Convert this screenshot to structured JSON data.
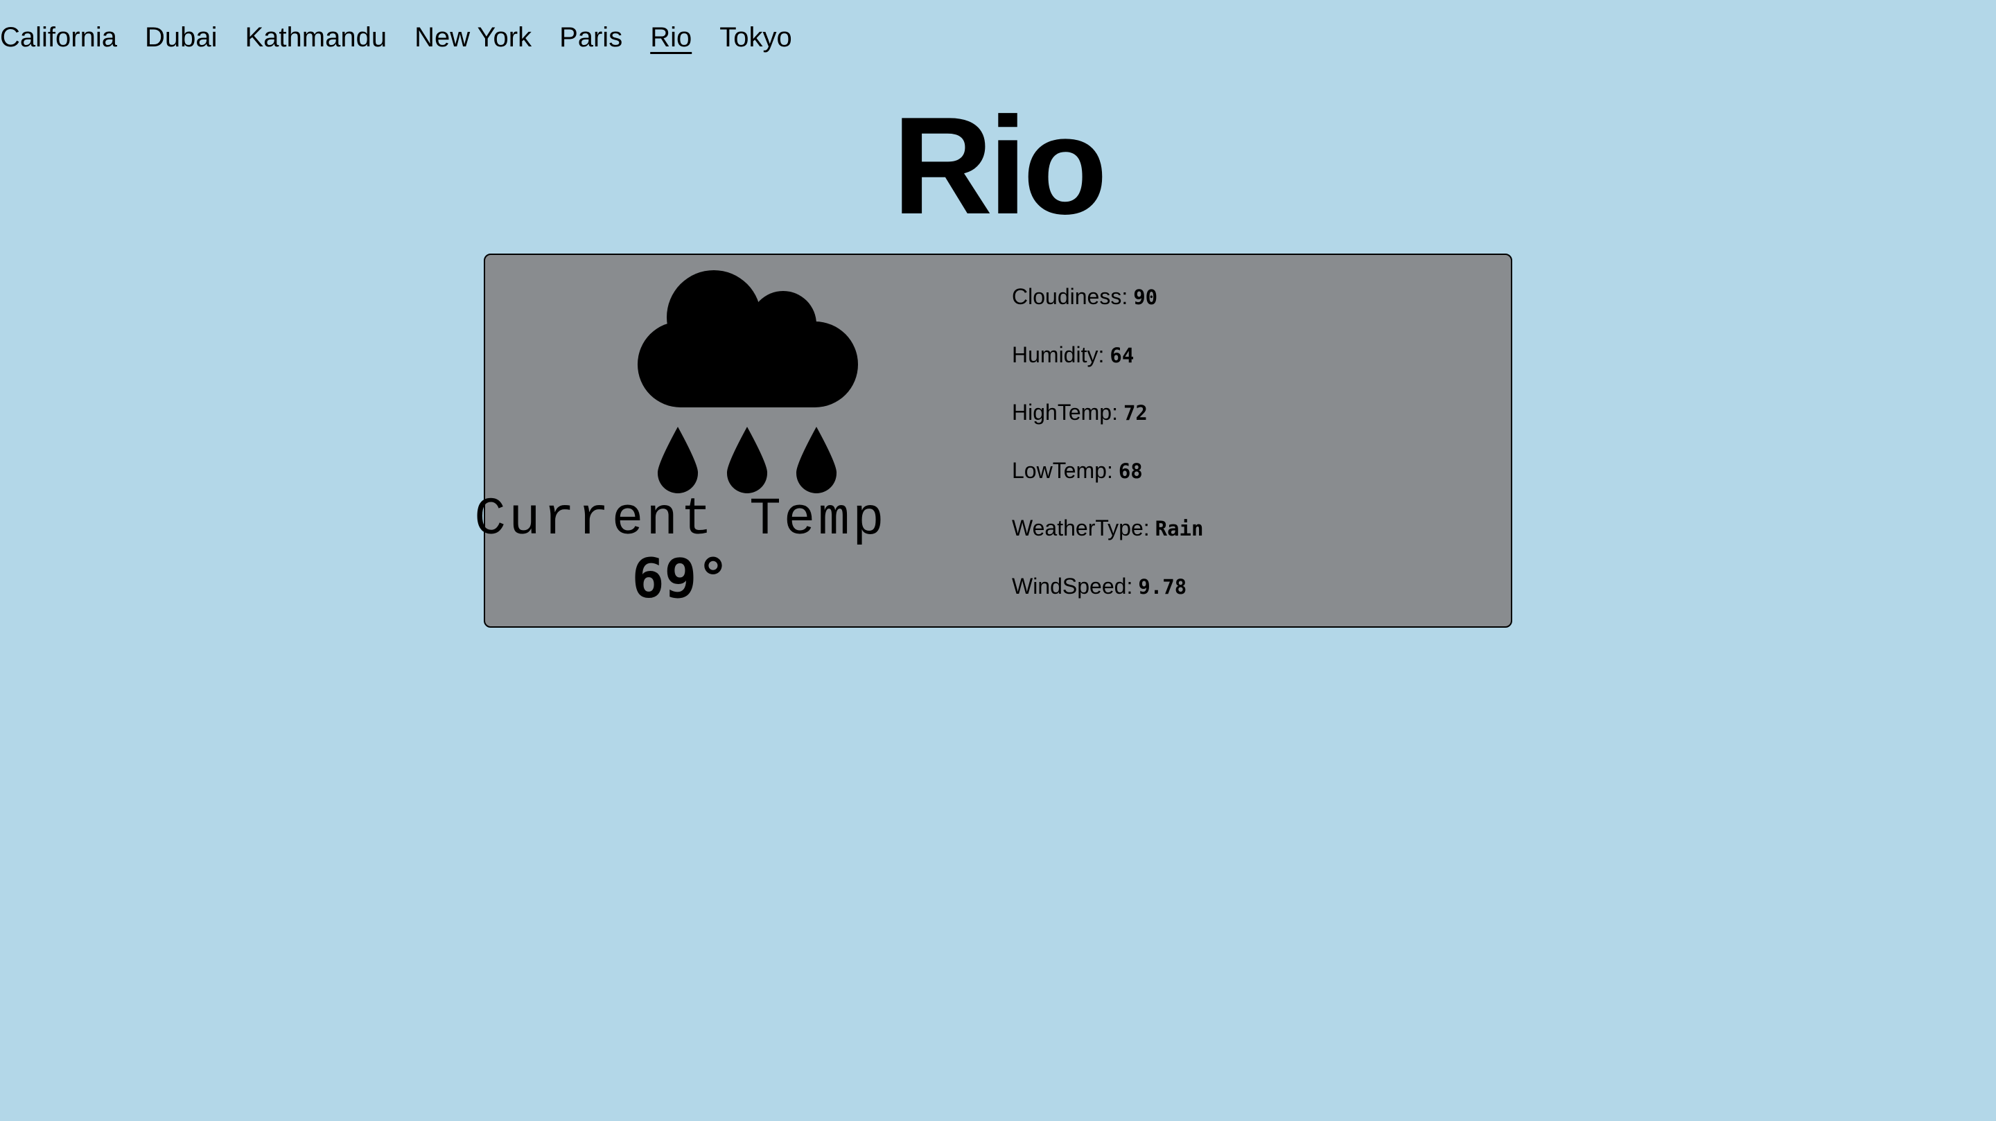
{
  "nav": {
    "cities": [
      {
        "label": "California"
      },
      {
        "label": "Dubai"
      },
      {
        "label": "Kathmandu"
      },
      {
        "label": "New York"
      },
      {
        "label": "Paris"
      },
      {
        "label": "Rio",
        "active": true
      },
      {
        "label": "Tokyo"
      }
    ]
  },
  "city": {
    "title": "Rio"
  },
  "weather": {
    "icon": "rain-cloud-icon",
    "current_label": "Current Temp",
    "current_value": "69°",
    "stats": [
      {
        "label": "Cloudiness:",
        "value": "90"
      },
      {
        "label": "Humidity:",
        "value": "64"
      },
      {
        "label": "HighTemp:",
        "value": "72"
      },
      {
        "label": "LowTemp:",
        "value": "68"
      },
      {
        "label": "WeatherType:",
        "value": "Rain"
      },
      {
        "label": "WindSpeed:",
        "value": "9.78"
      }
    ]
  },
  "colors": {
    "background": "#b3d7e8",
    "card": "#898c8f",
    "text": "#000000"
  }
}
